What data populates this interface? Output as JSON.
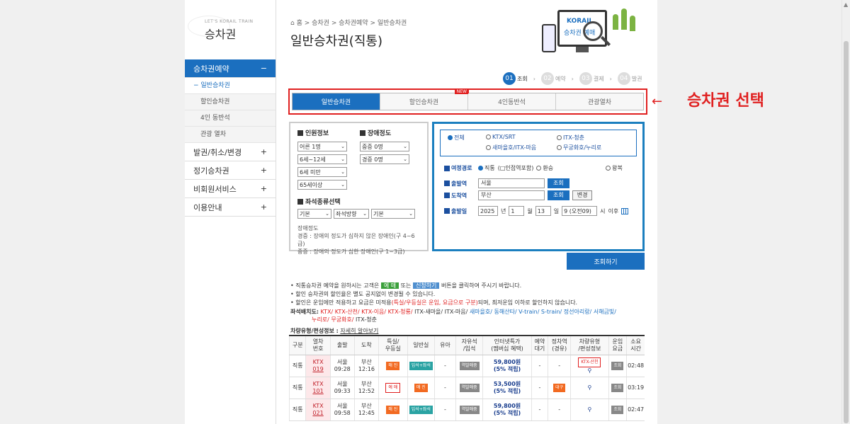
{
  "sidebar": {
    "logo_small": "LET'S KORAIL TRAIN",
    "logo_big": "승차권",
    "menus": [
      {
        "label": "승차권예약",
        "toggle": "−"
      },
      {
        "label": "발권/취소/변경",
        "toggle": "+"
      },
      {
        "label": "정기승차권",
        "toggle": "+"
      },
      {
        "label": "비회원서비스",
        "toggle": "+"
      },
      {
        "label": "이용안내",
        "toggle": "+"
      }
    ],
    "submenu": [
      "− 일반승차권",
      "할인승차권",
      "4인 동반석",
      "관광 열차"
    ]
  },
  "breadcrumb": "⌂ 홈 > 승차권 > 승차권예약 > 일반승차권",
  "page_title": "일반승차권(직통)",
  "hero": {
    "logo": "KORAIL",
    "text": "승차권 예매"
  },
  "steps": [
    {
      "num": "01",
      "label": "조회"
    },
    {
      "num": "02",
      "label": "예약"
    },
    {
      "num": "03",
      "label": "결제"
    },
    {
      "num": "04",
      "label": "발권"
    }
  ],
  "tabs": [
    "일반승차권",
    "할인승차권",
    "4인동반석",
    "관광열차"
  ],
  "tab_new": "NEW",
  "annotation": {
    "arrow": "←",
    "text": "승차권 선택"
  },
  "passengers": {
    "title": "인원정보",
    "adult": "어른 1명",
    "child": "6세~12세",
    "infant": "6세 미만",
    "senior": "65세이상",
    "disability_title": "장애정도",
    "severe": "중증 0명",
    "mild": "경증 0명"
  },
  "seat": {
    "title": "좌석종류선택",
    "opt1": "기본",
    "opt2": "좌석방향",
    "opt3": "기본",
    "desc_title": "장애정도",
    "desc1": "경증 : 장애의 정도가 심하지 않은 장애인(구 4~6급)",
    "desc2": "중증 : 장애의 정도가 심한 장애인(구 1~3급)"
  },
  "train_types": {
    "all": "전체",
    "ktx": "KTX/SRT",
    "itx": "ITX-청춘",
    "saemaeul": "새마을호/ITX-마음",
    "mugunghwa": "무궁화호/누리로"
  },
  "route": {
    "label": "여정경로",
    "direct": "직통",
    "nearby": "(□인접역포함)",
    "transfer": "환승",
    "round": "왕복",
    "dep_label": "출발역",
    "dep_value": "서울",
    "arr_label": "도착역",
    "arr_value": "부산",
    "lookup": "조회",
    "change": "변경"
  },
  "date": {
    "label": "출발일",
    "year": "2025",
    "y": "년",
    "month": "1",
    "m": "월",
    "day": "13",
    "d": "일",
    "hour": "9 (오전09)",
    "h": "시",
    "after": "이후"
  },
  "search_button": "조회하기",
  "notes": {
    "l1a": "• 직통승차권 예약을 원하시는 고객은",
    "l1b": "예 매",
    "l1c": "또는",
    "l1d": "신청하기",
    "l1e": "버튼을 클릭하여 주시기 바랍니다.",
    "l2": "• 할인 승차권의 할인율은 별도 공지없이 변경될 수 있습니다.",
    "l3a": "• 할인은 운임에만 적용하고 요금은 미적용",
    "l3b": "(특실/우등실은 운임, 요금으로 구분)",
    "l3c": "되며, 최저운임 이하로 할인하지 않습니다."
  },
  "seatmap": {
    "label": "좌석배치도:",
    "red": "KTX/ KTX-산천/ KTX-이음/ KTX-청룡/",
    "mid": " ITX-새마을/ ITX-마음/",
    "blue": " 새마을호/ 동해산타/ V-train/ S-train/ 정선아리랑/ 서해금빛/",
    "red2": "누리로/ 무궁화호/",
    "end": " ITX-청춘"
  },
  "carinfo": {
    "label": "차량유형/편성정보 :",
    "link": "자세히 알아보기"
  },
  "table": {
    "headers": [
      "구분",
      "열차\n번호",
      "출발",
      "도착",
      "특실/\n우등실",
      "일반실",
      "유아",
      "자유석\n/입석",
      "인터넷특가\n(멤버십 혜택)",
      "예약\n대기",
      "정차역\n(경유)",
      "차량유형\n/편성정보",
      "운임\n요금",
      "소요\n시간"
    ],
    "rows": [
      {
        "type": "직통",
        "train": "KTX",
        "no": "019",
        "dep": "서울",
        "dep_t": "09:28",
        "arr": "부산",
        "arr_t": "12:16",
        "first": "매 진",
        "normal": "입석+좌석",
        "infant": "-",
        "free": "역발매중",
        "price": "59,800원",
        "disc": "(5% 적립)",
        "wait": "-",
        "stops": "-",
        "car": "KTX-산천",
        "fare": "조회",
        "dur": "02:48"
      },
      {
        "type": "직통",
        "train": "KTX",
        "no": "101",
        "dep": "서울",
        "dep_t": "09:33",
        "arr": "부산",
        "arr_t": "12:52",
        "first": "예 매",
        "normal": "매 진",
        "infant": "-",
        "free": "역발매중",
        "price": "53,500원",
        "disc": "(5% 적립)",
        "wait": "-",
        "stops": "대구",
        "car": "",
        "fare": "조회",
        "dur": "03:19"
      },
      {
        "type": "직통",
        "train": "KTX",
        "no": "021",
        "dep": "서울",
        "dep_t": "09:58",
        "arr": "부산",
        "arr_t": "12:45",
        "first": "매 진",
        "normal": "입석+좌석",
        "infant": "-",
        "free": "역발매중",
        "price": "59,800원",
        "disc": "(5% 적립)",
        "wait": "-",
        "stops": "-",
        "car": "",
        "fare": "조회",
        "dur": "02:47"
      }
    ]
  }
}
